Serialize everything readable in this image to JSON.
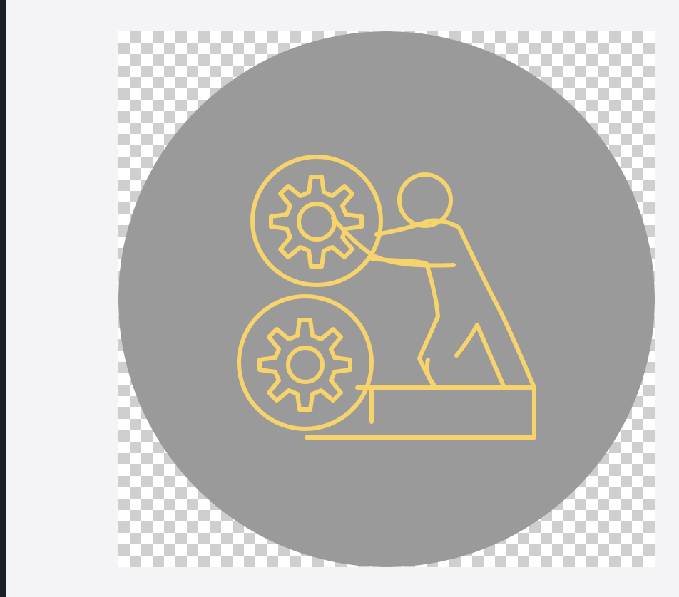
{
  "colors": {
    "window_edge": "#1b1f27",
    "workspace_background": "#f4f4f6",
    "checker_light": "#ffffff",
    "checker_dark": "#cfcfcf",
    "circle_fill": "#9a9a9a",
    "icon_stroke": "#f6d36b"
  },
  "image": {
    "icon_names": [
      "gear-icon",
      "gear-icon",
      "person-icon",
      "platform-icon"
    ]
  }
}
